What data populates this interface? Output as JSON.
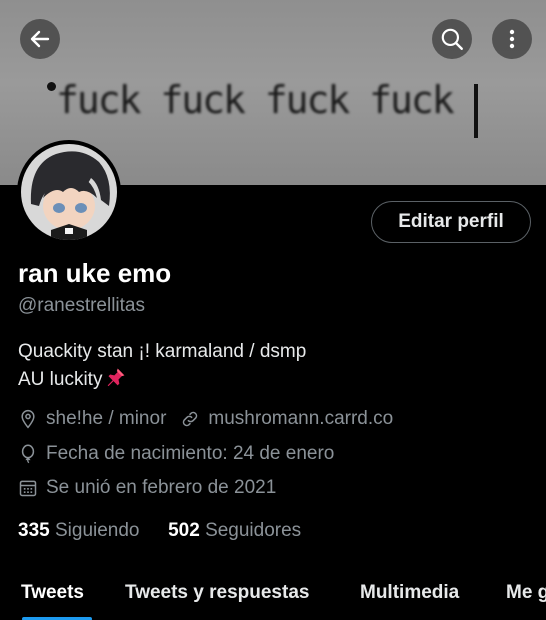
{
  "banner": {
    "text": "fuck fuck fuck fuck"
  },
  "header": {
    "back_icon": "arrow-left-icon",
    "search_icon": "search-icon",
    "more_icon": "more-vertical-icon"
  },
  "profile": {
    "edit_label": "Editar perfil",
    "name": "ran uke emo",
    "handle": "@ranestrellitas",
    "bio_line1": "Quackity stan ¡!  karmaland / dsmp",
    "bio_line2": "AU luckity",
    "location": "she!he / minor",
    "website": "mushromann.carrd.co",
    "birthday": "Fecha de nacimiento: 24 de enero",
    "joined": "Se unió en febrero de 2021",
    "following_count": "335",
    "following_label": "Siguiendo",
    "followers_count": "502",
    "followers_label": "Seguidores"
  },
  "tabs": [
    {
      "label": "Tweets"
    },
    {
      "label": "Tweets y respuestas"
    },
    {
      "label": "Multimedia"
    },
    {
      "label": "Me g"
    }
  ],
  "colors": {
    "accent": "#1d9bf0",
    "background": "#000000",
    "secondary_text": "#8b9298"
  }
}
